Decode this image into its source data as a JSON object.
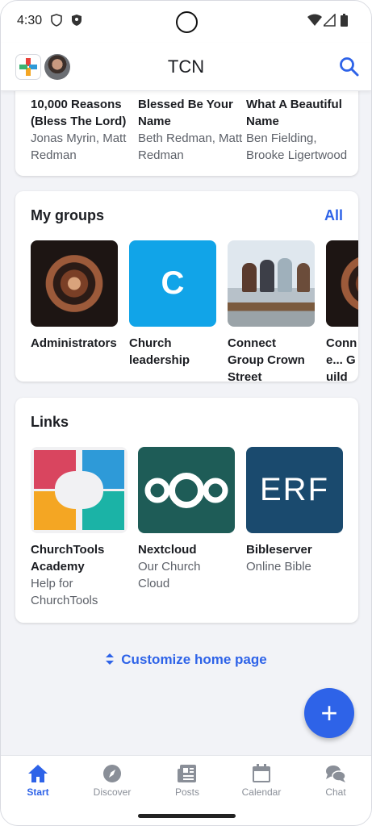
{
  "status_bar": {
    "time": "4:30"
  },
  "app_bar": {
    "title": "TCN"
  },
  "songs": [
    {
      "title": "10,000 Reasons (Bless The Lord)",
      "artist": "Jonas Myrin, Matt Redman"
    },
    {
      "title": "Blessed Be Your Name",
      "artist": "Beth Redman, Matt Redman"
    },
    {
      "title": "What A Beautiful Name",
      "artist": "Ben Fielding, Brooke Ligertwood"
    }
  ],
  "groups": {
    "title": "My groups",
    "all_label": "All",
    "items": [
      {
        "name": "Administrators"
      },
      {
        "name": "Church leadership",
        "letter": "C"
      },
      {
        "name": "Connect Group Crown Street"
      },
      {
        "name": "Conne... Guild"
      }
    ]
  },
  "links": {
    "title": "Links",
    "items": [
      {
        "name": "ChurchTools Academy",
        "subtitle": "Help for ChurchTools"
      },
      {
        "name": "Nextcloud",
        "subtitle": "Our Church Cloud"
      },
      {
        "name": "Bibleserver",
        "subtitle": "Online Bible",
        "logo_text": "ERF"
      }
    ]
  },
  "customize_label": "Customize home page",
  "fab_label": "+",
  "nav": [
    {
      "label": "Start",
      "icon": "home-icon",
      "active": true
    },
    {
      "label": "Discover",
      "icon": "compass-icon",
      "active": false
    },
    {
      "label": "Posts",
      "icon": "newspaper-icon",
      "active": false
    },
    {
      "label": "Calendar",
      "icon": "calendar-icon",
      "active": false
    },
    {
      "label": "Chat",
      "icon": "chat-icon",
      "active": false
    }
  ],
  "colors": {
    "accent": "#2e63e8",
    "group_c": "#11a4e8",
    "nextcloud": "#1e5c57",
    "bibleserver": "#1a4a6e"
  }
}
